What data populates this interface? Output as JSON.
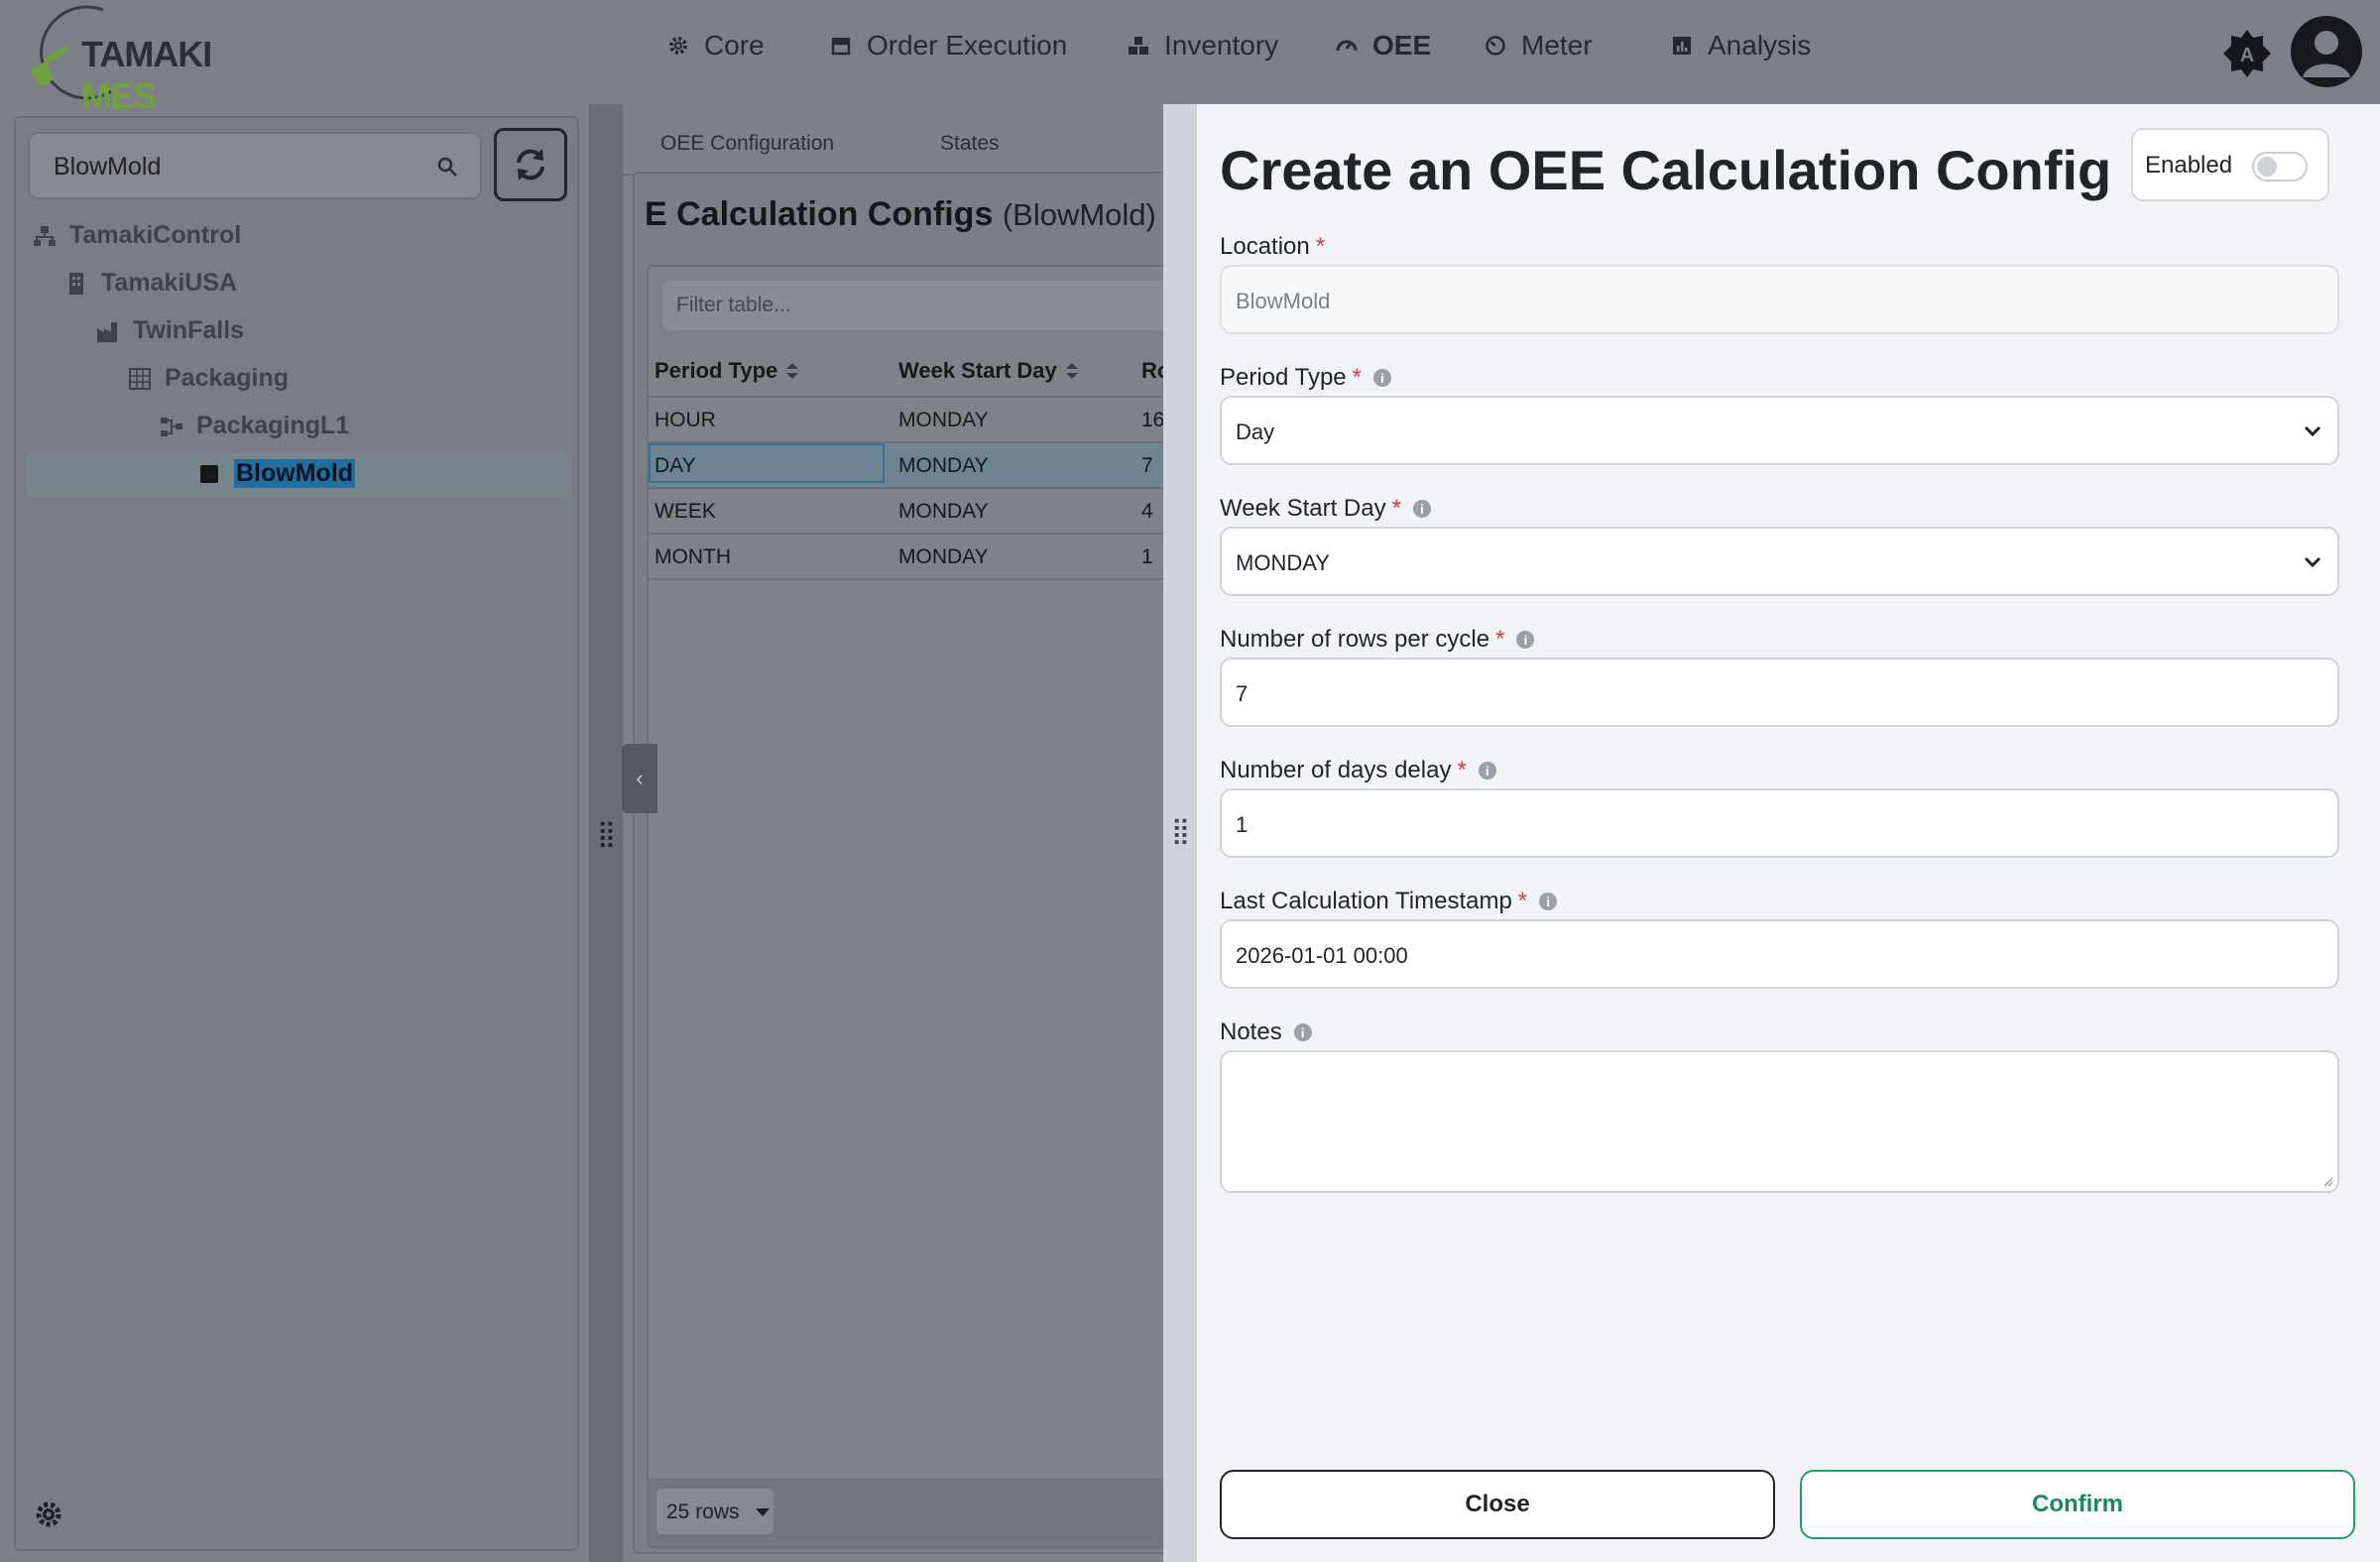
{
  "app": {
    "brand_part1": "TAMAKI",
    "brand_part2": "MES"
  },
  "nav": {
    "items": [
      {
        "label": "Core",
        "icon": "gear-icon"
      },
      {
        "label": "Order Execution",
        "icon": "store-icon"
      },
      {
        "label": "Inventory",
        "icon": "boxes-icon"
      },
      {
        "label": "OEE",
        "icon": "gauge-icon",
        "active": true
      },
      {
        "label": "Meter",
        "icon": "dial-icon"
      },
      {
        "label": "Analysis",
        "icon": "chart-icon"
      }
    ]
  },
  "sidebar": {
    "search_value": "BlowMold",
    "tree": [
      {
        "label": "TamakiControl",
        "icon": "sitemap-icon"
      },
      {
        "label": "TamakiUSA",
        "icon": "building-icon"
      },
      {
        "label": "TwinFalls",
        "icon": "factory-icon"
      },
      {
        "label": "Packaging",
        "icon": "grid-icon"
      },
      {
        "label": "PackagingL1",
        "icon": "line-icon"
      },
      {
        "label": "BlowMold",
        "icon": "square-icon",
        "selected": true
      }
    ]
  },
  "main": {
    "tabs": [
      "OEE Configuration",
      "States"
    ],
    "title": "E Calculation Configs",
    "title_sub": "(BlowMold)",
    "filter_placeholder": "Filter table...",
    "columns": [
      "Period Type",
      "Week Start Day",
      "Ro"
    ],
    "rows": [
      [
        "HOUR",
        "MONDAY",
        "16"
      ],
      [
        "DAY",
        "MONDAY",
        "7"
      ],
      [
        "WEEK",
        "MONDAY",
        "4"
      ],
      [
        "MONTH",
        "MONDAY",
        "1"
      ]
    ],
    "rows_per_page": "25 rows"
  },
  "drawer": {
    "title": "Create an OEE Calculation Config",
    "enabled_label": "Enabled",
    "enabled": false,
    "fields": {
      "location": {
        "label": "Location",
        "value": "BlowMold"
      },
      "period_type": {
        "label": "Period Type",
        "value": "Day"
      },
      "week_start_day": {
        "label": "Week Start Day",
        "value": "MONDAY"
      },
      "rows_per_cycle": {
        "label": "Number of rows per cycle",
        "value": "7"
      },
      "days_delay": {
        "label": "Number of days delay",
        "value": "1"
      },
      "last_calc": {
        "label": "Last Calculation Timestamp",
        "value": "2026-01-01 00:00"
      },
      "notes": {
        "label": "Notes",
        "value": ""
      }
    },
    "close_label": "Close",
    "confirm_label": "Confirm"
  },
  "colors": {
    "accent_green": "#1e9e6a",
    "required_red": "#dc3545",
    "brand_green": "#6fa23a"
  }
}
